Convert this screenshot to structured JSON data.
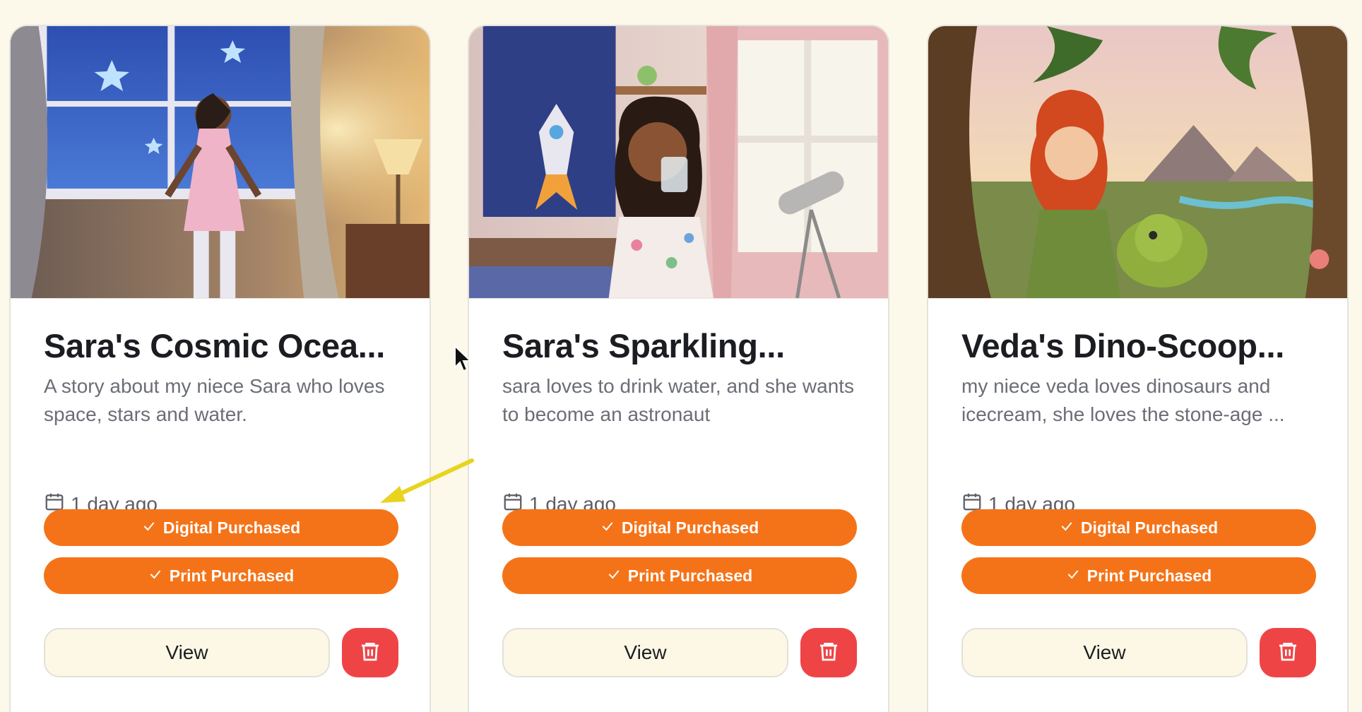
{
  "colors": {
    "page_background": "#fdf9ea",
    "purchase_badge": "#f57318",
    "delete_button": "#ef4445",
    "view_button": "#fdf8e6",
    "annotation_arrow": "#e8d41f"
  },
  "cards": [
    {
      "title": "Sara's Cosmic Ocea...",
      "description": "A story about my niece Sara who loves space, stars and water.",
      "date": "1 day ago",
      "digital_badge": "Digital Purchased",
      "print_badge": "Print Purchased",
      "view_label": "View",
      "delete_icon": "trash-icon"
    },
    {
      "title": "Sara's Sparkling...",
      "description": "sara loves to drink water, and she wants to become an astronaut",
      "date": "1 day ago",
      "digital_badge": "Digital Purchased",
      "print_badge": "Print Purchased",
      "view_label": "View",
      "delete_icon": "trash-icon"
    },
    {
      "title": "Veda's Dino-Scoop...",
      "description": "my niece veda loves dinosaurs and icecream, she loves the stone-age ...",
      "date": "1 day ago",
      "digital_badge": "Digital Purchased",
      "print_badge": "Print Purchased",
      "view_label": "View",
      "delete_icon": "trash-icon"
    }
  ],
  "icons": {
    "date": "calendar-icon",
    "badge": "check-icon",
    "delete": "trash-icon"
  }
}
